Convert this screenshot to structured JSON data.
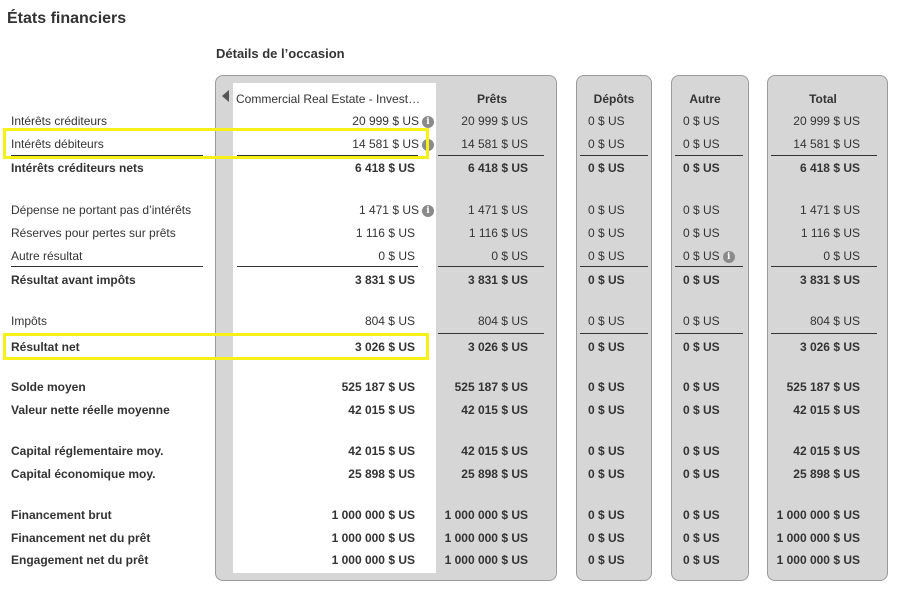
{
  "page_title": "États financiers",
  "section_title": "Détails de l’occasion",
  "columns": {
    "opportunity": "Commercial Real Estate - Investment Property",
    "loans": "Prêts",
    "deposits": "Dépôts",
    "other": "Autre",
    "total": "Total"
  },
  "rows": [
    {
      "label": "Intérêts créditeurs",
      "bold": false,
      "opp": "20 999 $ US",
      "opp_info": true,
      "loans": "20 999 $ US",
      "deposits": "0 $ US",
      "other": "0 $ US",
      "other_info": false,
      "total": "20 999 $ US"
    },
    {
      "label": "Intérêts débiteurs",
      "bold": false,
      "opp": "14 581 $ US",
      "opp_info": true,
      "loans": "14 581 $ US",
      "deposits": "0 $ US",
      "other": "0 $ US",
      "other_info": false,
      "total": "14 581 $ US"
    },
    {
      "label": "Intérêts créditeurs nets",
      "bold": true,
      "opp": "6 418 $ US",
      "opp_info": false,
      "loans": "6 418 $ US",
      "deposits": "0 $ US",
      "other": "0 $ US",
      "other_info": false,
      "total": "6 418 $ US"
    },
    {
      "label": "Dépense ne portant pas d’intérêts",
      "bold": false,
      "opp": "1 471 $ US",
      "opp_info": true,
      "loans": "1 471 $ US",
      "deposits": "0 $ US",
      "other": "0 $ US",
      "other_info": false,
      "total": "1 471 $ US"
    },
    {
      "label": "Réserves pour pertes sur prêts",
      "bold": false,
      "opp": "1 116 $ US",
      "opp_info": false,
      "loans": "1 116 $ US",
      "deposits": "0 $ US",
      "other": "0 $ US",
      "other_info": false,
      "total": "1 116 $ US"
    },
    {
      "label": "Autre résultat",
      "bold": false,
      "opp": "0 $ US",
      "opp_info": false,
      "loans": "0 $ US",
      "deposits": "0 $ US",
      "other": "0 $ US",
      "other_info": true,
      "total": "0 $ US"
    },
    {
      "label": "Résultat avant impôts",
      "bold": true,
      "opp": "3 831 $ US",
      "opp_info": false,
      "loans": "3 831 $ US",
      "deposits": "0 $ US",
      "other": "0 $ US",
      "other_info": false,
      "total": "3 831 $ US"
    },
    {
      "label": "Impôts",
      "bold": false,
      "opp": "804 $ US",
      "opp_info": false,
      "loans": "804 $ US",
      "deposits": "0 $ US",
      "other": "0 $ US",
      "other_info": false,
      "total": "804 $ US"
    },
    {
      "label": "Résultat net",
      "bold": true,
      "opp": "3 026 $ US",
      "opp_info": false,
      "loans": "3 026 $ US",
      "deposits": "0 $ US",
      "other": "0 $ US",
      "other_info": false,
      "total": "3 026 $ US"
    },
    {
      "label": "Solde moyen",
      "bold": true,
      "opp": "525 187 $ US",
      "opp_info": false,
      "loans": "525 187 $ US",
      "deposits": "0 $ US",
      "other": "0 $ US",
      "other_info": false,
      "total": "525 187 $ US"
    },
    {
      "label": "Valeur nette réelle moyenne",
      "bold": true,
      "opp": "42 015 $ US",
      "opp_info": false,
      "loans": "42 015 $ US",
      "deposits": "0 $ US",
      "other": "0 $ US",
      "other_info": false,
      "total": "42 015 $ US"
    },
    {
      "label": "Capital réglementaire moy.",
      "bold": true,
      "opp": "42 015 $ US",
      "opp_info": false,
      "loans": "42 015 $ US",
      "deposits": "0 $ US",
      "other": "0 $ US",
      "other_info": false,
      "total": "42 015 $ US"
    },
    {
      "label": "Capital économique moy.",
      "bold": true,
      "opp": "25 898 $ US",
      "opp_info": false,
      "loans": "25 898 $ US",
      "deposits": "0 $ US",
      "other": "0 $ US",
      "other_info": false,
      "total": "25 898 $ US"
    },
    {
      "label": "Financement brut",
      "bold": true,
      "opp": "1 000 000 $ US",
      "opp_info": false,
      "loans": "1 000 000 $ US",
      "deposits": "0 $ US",
      "other": "0 $ US",
      "other_info": false,
      "total": "1 000 000 $ US"
    },
    {
      "label": "Financement net du prêt",
      "bold": true,
      "opp": "1 000 000 $ US",
      "opp_info": false,
      "loans": "1 000 000 $ US",
      "deposits": "0 $ US",
      "other": "0 $ US",
      "other_info": false,
      "total": "1 000 000 $ US"
    },
    {
      "label": "Engagement net du prêt",
      "bold": true,
      "opp": "1 000 000 $ US",
      "opp_info": false,
      "loans": "1 000 000 $ US",
      "deposits": "0 $ US",
      "other": "0 $ US",
      "other_info": false,
      "total": "1 000 000 $ US"
    }
  ],
  "highlighted_rows": [
    "Intérêts débiteurs",
    "Résultat net"
  ]
}
